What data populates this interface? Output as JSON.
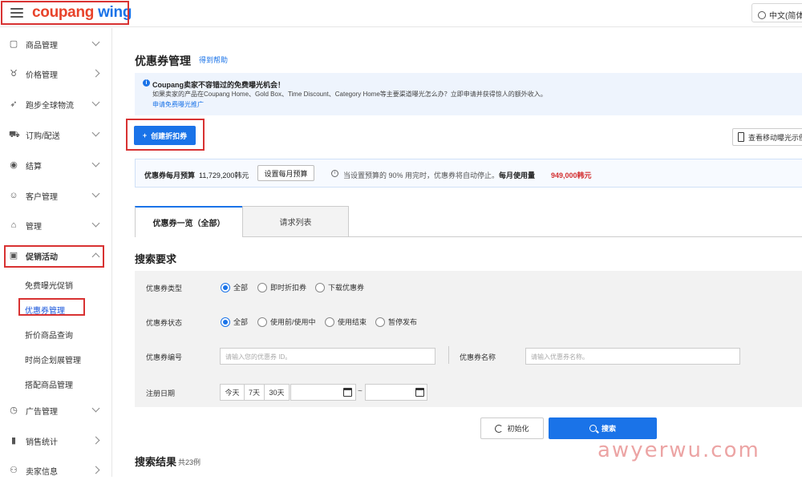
{
  "header": {
    "logo_part1": "coupang",
    "logo_part2": "wing",
    "language": "中文(简体"
  },
  "sidebar": {
    "items": [
      {
        "label": "商品管理",
        "icon": "box-icon"
      },
      {
        "label": "价格管理",
        "icon": "medal-icon"
      },
      {
        "label": "跑步全球物流",
        "icon": "rocket-icon"
      },
      {
        "label": "订购/配送",
        "icon": "truck-icon"
      },
      {
        "label": "结算",
        "icon": "coin-icon"
      },
      {
        "label": "客户管理",
        "icon": "smile-icon"
      },
      {
        "label": "管理",
        "icon": "store-icon"
      },
      {
        "label": "促销活动",
        "icon": "promo-icon"
      }
    ],
    "sub_items": [
      "免费曝光促销",
      "优惠券管理",
      "折价商品查询",
      "时尚企划展管理",
      "搭配商品管理"
    ],
    "bottom_items": [
      {
        "label": "广告管理",
        "icon": "clock-icon"
      },
      {
        "label": "销售统计",
        "icon": "bar-chart-icon"
      },
      {
        "label": "卖家信息",
        "icon": "user-icon"
      }
    ]
  },
  "page": {
    "title": "优惠券管理",
    "help": "得到帮助"
  },
  "notice": {
    "title": "Coupang卖家不容错过的免费曝光机会！",
    "desc": "如果卖家的产品在Coupang Home、Gold Box、Time Discount、Category Home等主要渠道曝光怎么办？立即申请并获得惊人的额外收入。",
    "link": "申请免费曝光推广"
  },
  "actions": {
    "create": "创建折扣券",
    "mobile_preview": "查看移动曝光示例"
  },
  "budget": {
    "label": "优惠券每月预算",
    "value": "11,729,200韩元",
    "set_button": "设置每月预算",
    "note": "当设置预算的 90% 用完时，优惠券将自动停止。",
    "usage_label": "每月使用量",
    "usage_value": "949,000韩元"
  },
  "tabs": [
    "优惠券一览（全部）",
    "请求列表"
  ],
  "search": {
    "title": "搜索要求",
    "type_label": "优惠券类型",
    "type_options": [
      "全部",
      "即时折扣券",
      "下载优惠券"
    ],
    "status_label": "优惠券状态",
    "status_options": [
      "全部",
      "使用前/使用中",
      "使用结束",
      "暂停发布"
    ],
    "id_label": "优惠券编号",
    "id_placeholder": "请输入您的优惠券 ID。",
    "name_label": "优惠券名称",
    "name_placeholder": "请输入优惠券名称。",
    "date_label": "注册日期",
    "day_buttons": [
      "今天",
      "7天",
      "30天"
    ],
    "date_separator": "~",
    "reset": "初始化",
    "submit": "搜索"
  },
  "results": {
    "title": "搜索结果",
    "count": "共23例"
  },
  "watermark": "awyerwu.com",
  "colors": {
    "accent": "#1a73e8",
    "highlight_box": "#d83232",
    "warning": "#d32f2f"
  }
}
